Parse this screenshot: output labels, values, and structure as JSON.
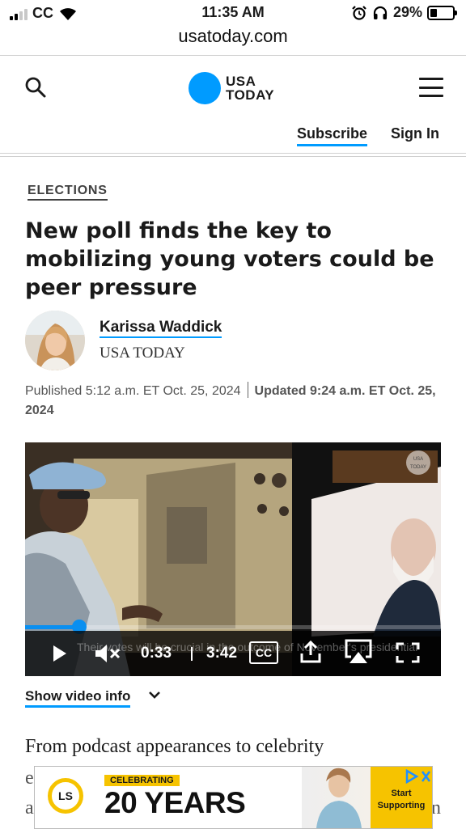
{
  "status_bar": {
    "carrier": "CC",
    "time": "11:35 AM",
    "battery_percent": "29%",
    "battery_level": 0.29
  },
  "browser": {
    "url": "usatoday.com"
  },
  "header": {
    "logo_line1": "USA",
    "logo_line2": "TODAY",
    "subscribe_label": "Subscribe",
    "signin_label": "Sign In",
    "accent_color": "#009bff"
  },
  "article": {
    "category": "ELECTIONS",
    "headline": "New poll finds the key to mobilizing young voters could be peer pressure",
    "author_name": "Karissa Waddick",
    "author_org": "USA TODAY",
    "published": "Published 5:12 a.m. ET Oct. 25, 2024",
    "updated": "Updated 9:24 a.m. ET Oct. 25, 2024",
    "body_first_line": "From podcast appearances to celebrity",
    "body_peek_left_1": "e",
    "body_peek_left_2": "a",
    "body_peek_right": "n"
  },
  "video": {
    "current_time": "0:33",
    "duration": "3:42",
    "progress": 0.13,
    "cc_label": "CC",
    "caption_text": "Their votes will be crucial in the outcome of November's presidential",
    "watermark": "USA TODAY",
    "show_info_label": "Show video info"
  },
  "ad": {
    "logo_text": "LS",
    "celebrating": "CELEBRATING",
    "headline": "20 YEARS",
    "cta_line1": "Start",
    "cta_line2": "Supporting",
    "brand_color": "#f6c300"
  }
}
